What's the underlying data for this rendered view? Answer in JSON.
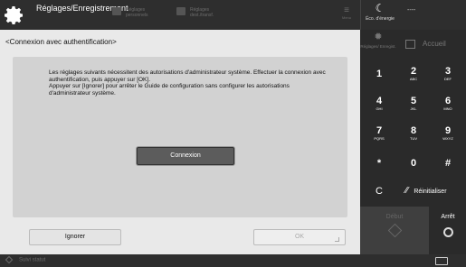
{
  "topbar": {
    "title": "Réglages/Enregistrement",
    "item1": "Réglages personnels",
    "item2": "Réglages dest./transf.",
    "menu": "Menu",
    "eco": "Éco. d'énergie",
    "status": "----"
  },
  "content": {
    "heading": "<Connexion avec authentification>",
    "message": "Les réglages suivants nécessitent des autorisations d'administrateur système. Effectuer la connexion avec authentification, puis appuyer sur [OK].\nAppuyer sur [Ignorer] pour arrêter le Guide de configuration sans configurer les autorisations d'administrateur système.",
    "connexion_label": "Connexion",
    "ignorer_label": "Ignorer",
    "ok_label": "OK"
  },
  "keypad": {
    "shortcut_label": "Réglages/ Enregist.",
    "home_label": "Accueil",
    "keys": [
      {
        "n": "1",
        "s": ""
      },
      {
        "n": "2",
        "s": "ABC"
      },
      {
        "n": "3",
        "s": "DEF"
      },
      {
        "n": "4",
        "s": "GHI"
      },
      {
        "n": "5",
        "s": "JKL"
      },
      {
        "n": "6",
        "s": "MNO"
      },
      {
        "n": "7",
        "s": "PQRS"
      },
      {
        "n": "8",
        "s": "TUV"
      },
      {
        "n": "9",
        "s": "WXYZ"
      },
      {
        "n": "*",
        "s": ""
      },
      {
        "n": "0",
        "s": ""
      },
      {
        "n": "#",
        "s": ""
      }
    ],
    "clear": "C",
    "reset_label": "Réinitialiser",
    "start_label": "Début",
    "stop_label": "Arrêt"
  },
  "statusbar": {
    "status_label": "Suivi statut"
  }
}
